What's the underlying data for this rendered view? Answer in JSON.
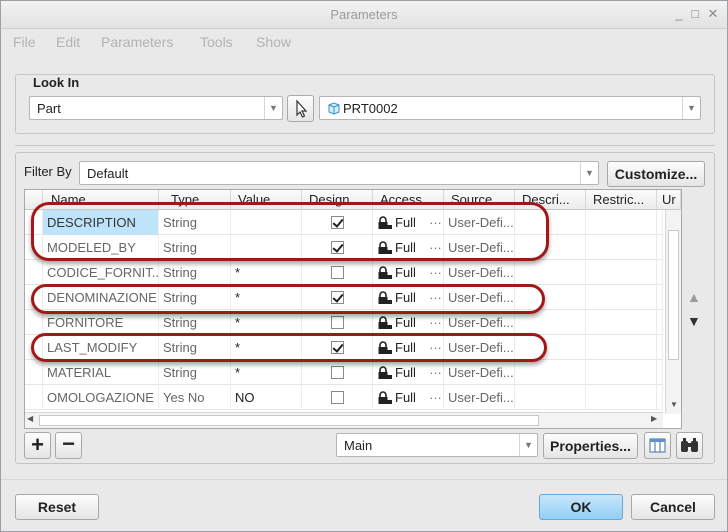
{
  "window": {
    "title": "Parameters",
    "minimize": "_",
    "maximize": "□",
    "close": "✕"
  },
  "menu": [
    "File",
    "Edit",
    "Parameters",
    "Tools",
    "Show"
  ],
  "look_in": {
    "label": "Look In",
    "type_value": "Part",
    "item_value": "PRT0002"
  },
  "filter": {
    "label": "Filter By",
    "value": "Default",
    "customize_label": "Customize..."
  },
  "table": {
    "columns": [
      "Name",
      "Type",
      "Value",
      "Design...",
      "Access",
      "Source",
      "Descri...",
      "Restric...",
      "Ur"
    ],
    "rows": [
      {
        "name": "DESCRIPTION",
        "type": "String",
        "value": "",
        "designate": true,
        "access": "Full",
        "source": "User-Defi...",
        "selected": true
      },
      {
        "name": "MODELED_BY",
        "type": "String",
        "value": "",
        "designate": true,
        "access": "Full",
        "source": "User-Defi...",
        "selected": false
      },
      {
        "name": "CODICE_FORNIT...",
        "type": "String",
        "value": "*",
        "designate": false,
        "access": "Full",
        "source": "User-Defi...",
        "selected": false
      },
      {
        "name": "DENOMINAZIONE",
        "type": "String",
        "value": "*",
        "designate": true,
        "access": "Full",
        "source": "User-Defi...",
        "selected": false
      },
      {
        "name": "FORNITORE",
        "type": "String",
        "value": "*",
        "designate": false,
        "access": "Full",
        "source": "User-Defi...",
        "selected": false
      },
      {
        "name": "LAST_MODIFY",
        "type": "String",
        "value": "*",
        "designate": true,
        "access": "Full",
        "source": "User-Defi...",
        "selected": false
      },
      {
        "name": "MATERIAL",
        "type": "String",
        "value": "*",
        "designate": false,
        "access": "Full",
        "source": "User-Defi...",
        "selected": false
      },
      {
        "name": "OMOLOGAZIONE",
        "type": "Yes No",
        "value": "NO",
        "designate": false,
        "access": "Full",
        "source": "User-Defi...",
        "selected": false
      }
    ]
  },
  "bottom_bar": {
    "add_label": "+",
    "remove_label": "−",
    "view_value": "Main",
    "properties_label": "Properties..."
  },
  "footer": {
    "reset_label": "Reset",
    "ok_label": "OK",
    "cancel_label": "Cancel"
  },
  "colors": {
    "highlight_oval": "#a21818",
    "selected_cell": "#bfe3fb",
    "ok_button": "#92cff5"
  }
}
